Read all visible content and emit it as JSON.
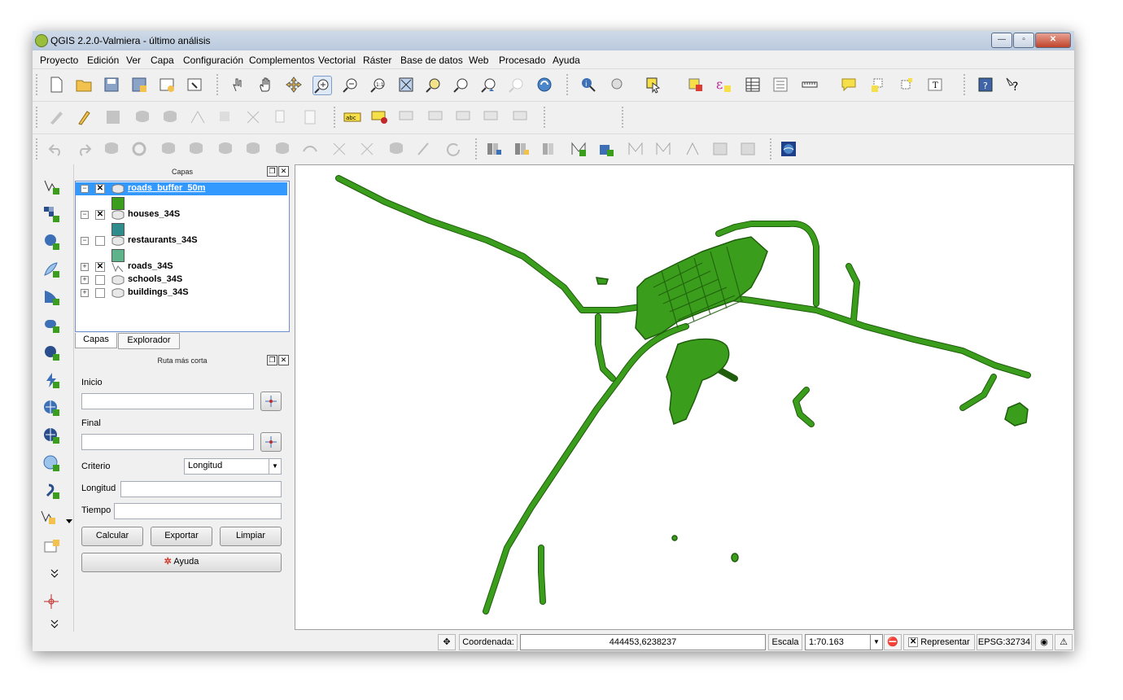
{
  "window": {
    "title": "QGIS 2.2.0-Valmiera - último análisis",
    "buttons": [
      "—",
      "▫",
      "✕"
    ]
  },
  "menu": [
    "Proyecto",
    "Edición",
    "Ver",
    "Capa",
    "Configuración",
    "Complementos",
    "Vectorial",
    "Ráster",
    "Base de datos",
    "Web",
    "Procesado",
    "Ayuda"
  ],
  "layers_panel": {
    "title": "Capas",
    "layers": [
      {
        "name": "roads_buffer_50m",
        "checked": true,
        "expanded": true,
        "selected": true,
        "color": "#3a9e1c"
      },
      {
        "name": "houses_34S",
        "checked": true,
        "expanded": true,
        "color": "#2e8c8c"
      },
      {
        "name": "restaurants_34S",
        "checked": false,
        "expanded": true,
        "color": "#5fb38a"
      },
      {
        "name": "roads_34S",
        "checked": true,
        "expanded": false
      },
      {
        "name": "schools_34S",
        "checked": false,
        "expanded": false
      },
      {
        "name": "buildings_34S",
        "checked": false,
        "expanded": false
      }
    ],
    "tabs": [
      "Capas",
      "Explorador"
    ]
  },
  "route_panel": {
    "title": "Ruta más corta",
    "start_label": "Inicio",
    "end_label": "Final",
    "criterion_label": "Criterio",
    "criterion_value": "Longitud",
    "length_label": "Longitud",
    "time_label": "Tiempo",
    "calc_button": "Calcular",
    "export_button": "Exportar",
    "clear_button": "Limpiar",
    "help_button": "Ayuda"
  },
  "status": {
    "coord_label": "Coordenada:",
    "coord_value": "444453,6238237",
    "scale_label": "Escala",
    "scale_value": "1:70.163",
    "render_label": "Representar",
    "crs": "EPSG:32734"
  },
  "map": {
    "feature_color": "#3a9e1c",
    "outline_color": "#1f5c0c"
  }
}
